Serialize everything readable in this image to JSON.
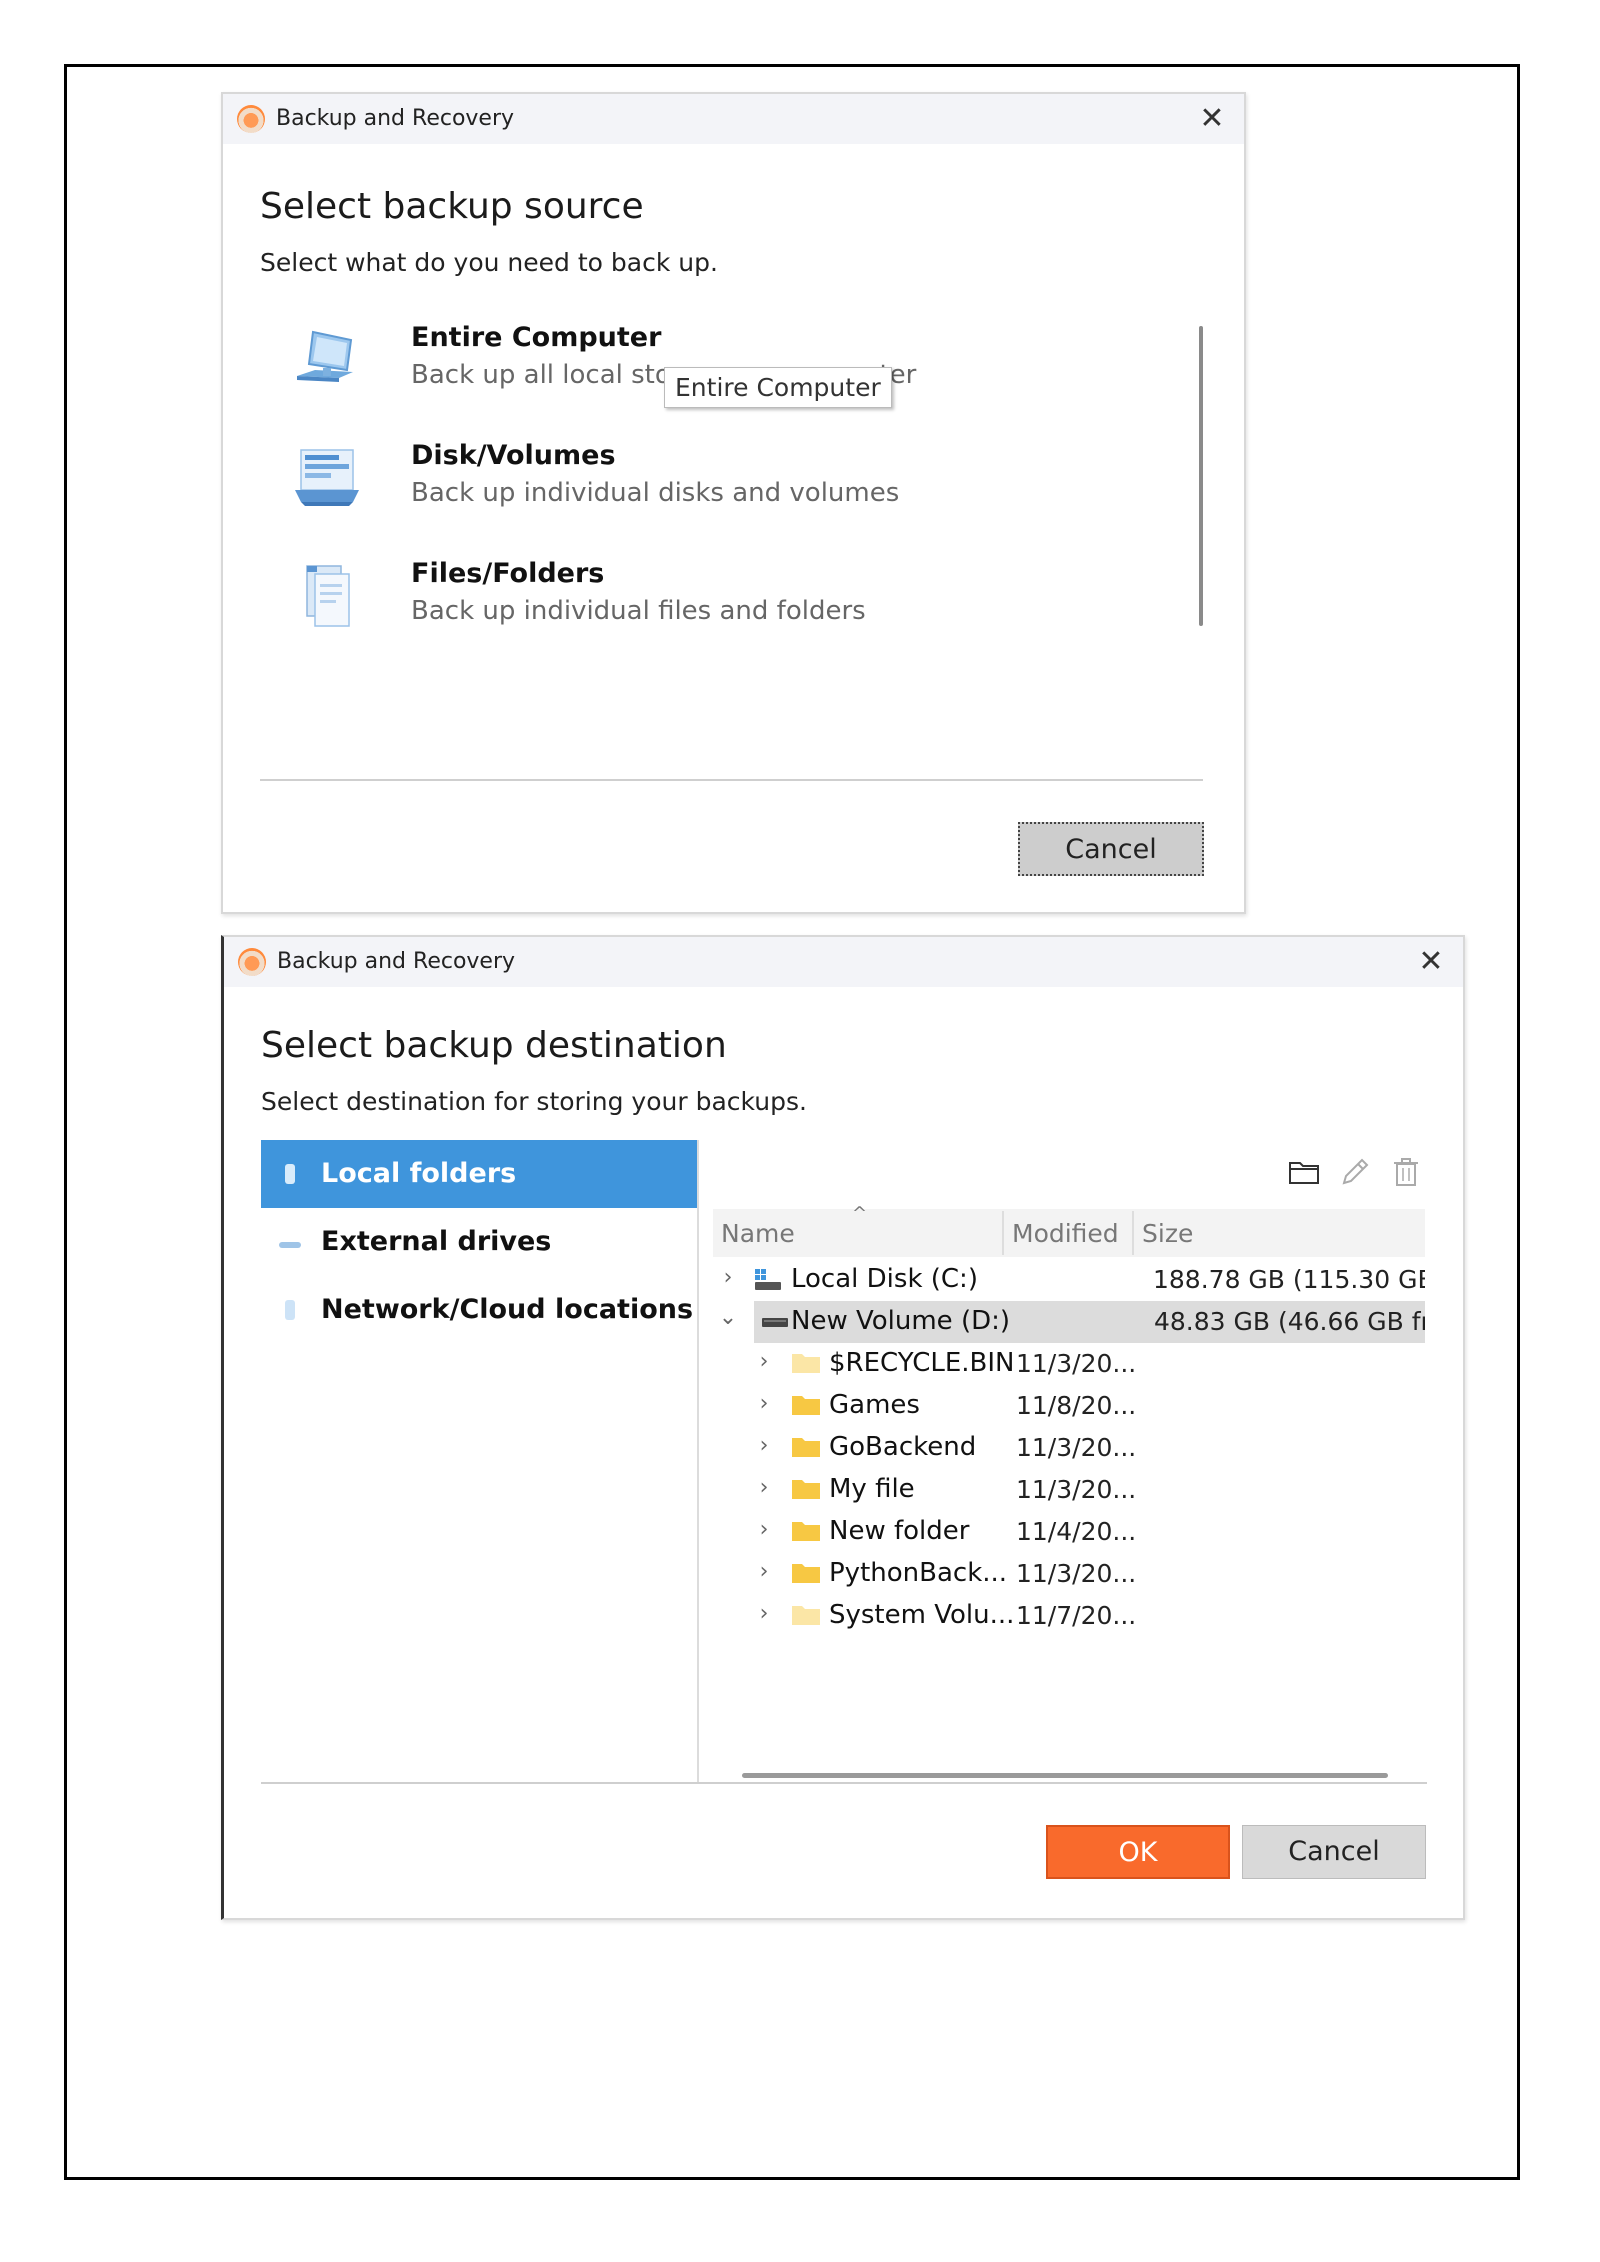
{
  "source_dialog": {
    "title": "Backup and Recovery",
    "close_glyph": "✕",
    "heading": "Select backup source",
    "subheading": "Select what do you need to back up.",
    "options": [
      {
        "title": "Entire Computer",
        "description": "Back up all local stor",
        "description_tail": "uter",
        "icon": "computer-icon"
      },
      {
        "title": "Disk/Volumes",
        "description": "Back up individual disks and volumes",
        "icon": "disk-volumes-icon"
      },
      {
        "title": "Files/Folders",
        "description": "Back up individual files and folders",
        "icon": "files-folders-icon"
      }
    ],
    "tooltip": "Entire Computer",
    "cancel_label": "Cancel"
  },
  "destination_dialog": {
    "title": "Backup and Recovery",
    "close_glyph": "✕",
    "heading": "Select backup destination",
    "subheading": "Select destination for storing your backups.",
    "nav": [
      {
        "label": "Local folders",
        "active": true
      },
      {
        "label": "External drives",
        "active": false
      },
      {
        "label": "Network/Cloud locations",
        "active": false
      }
    ],
    "toolbar_icons": [
      "new-folder-icon",
      "rename-icon",
      "delete-icon"
    ],
    "columns": {
      "name": "Name",
      "modified": "Modified",
      "size": "Size",
      "sort_glyph": "^"
    },
    "drives": [
      {
        "name": "Local Disk (C:)",
        "size": "188.78 GB (115.30 GB fr",
        "expanded": false,
        "selected": false
      },
      {
        "name": "New Volume (D:)",
        "size": "48.83 GB (46.66 GB fr",
        "expanded": true,
        "selected": true
      }
    ],
    "folders": [
      {
        "name": "$RECYCLE.BIN",
        "modified": "11/3/20...",
        "faded": true
      },
      {
        "name": "Games",
        "modified": "11/8/20...",
        "faded": false
      },
      {
        "name": "GoBackend",
        "modified": "11/3/20...",
        "faded": false
      },
      {
        "name": "My file",
        "modified": "11/3/20...",
        "faded": false
      },
      {
        "name": "New folder",
        "modified": "11/4/20...",
        "faded": false
      },
      {
        "name": "PythonBack...",
        "modified": "11/3/20...",
        "faded": false
      },
      {
        "name": "System Volu...",
        "modified": "11/7/20...",
        "faded": true
      }
    ],
    "chevron_collapsed": "›",
    "chevron_expanded": "⌄",
    "ok_label": "OK",
    "cancel_label": "Cancel"
  },
  "colors": {
    "accent_blue": "#3f95dc",
    "ok_orange": "#f96a2c",
    "folder_yellow": "#f7c843"
  }
}
